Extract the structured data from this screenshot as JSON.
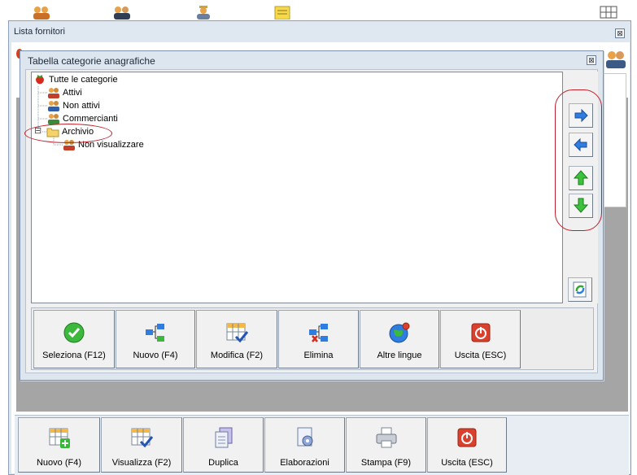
{
  "outer_window": {
    "title": "Lista fornitori",
    "close_glyph": "⊠",
    "bottom_buttons": [
      {
        "label": "Nuovo (F4)",
        "icon": "grid-add-icon"
      },
      {
        "label": "Visualizza (F2)",
        "icon": "grid-check-icon"
      },
      {
        "label": "Duplica",
        "icon": "duplicate-icon"
      },
      {
        "label": "Elaborazioni",
        "icon": "gear-document-icon"
      },
      {
        "label": "Stampa (F9)",
        "icon": "printer-icon"
      },
      {
        "label": "Uscita (ESC)",
        "icon": "power-icon"
      }
    ]
  },
  "dialog": {
    "title": "Tabella categorie anagrafiche",
    "close_glyph": "⊠",
    "tree": [
      {
        "label": "Tutte le categorie",
        "icon": "strawberry-icon",
        "level": 0
      },
      {
        "label": "Attivi",
        "icon": "users-icon",
        "level": 1
      },
      {
        "label": "Non attivi",
        "icon": "users-icon",
        "level": 1
      },
      {
        "label": "Commercianti",
        "icon": "users-icon",
        "level": 1
      },
      {
        "label": "Archivio",
        "icon": "folder-icon",
        "level": 1,
        "expanded": true,
        "expander": "⊟",
        "highlighted": true
      },
      {
        "label": "Non visualizzare",
        "icon": "users-icon",
        "level": 2
      }
    ],
    "side_buttons": [
      {
        "name": "move-right",
        "icon": "arrow-right-icon"
      },
      {
        "name": "move-left",
        "icon": "arrow-left-icon"
      },
      {
        "name": "move-up",
        "icon": "arrow-up-icon"
      },
      {
        "name": "move-down",
        "icon": "arrow-down-icon"
      },
      {
        "name": "refresh",
        "icon": "refresh-icon"
      }
    ],
    "buttons": [
      {
        "label": "Seleziona (F12)",
        "icon": "check-icon"
      },
      {
        "label": "Nuovo (F4)",
        "icon": "new-node-icon"
      },
      {
        "label": "Modifica (F2)",
        "icon": "grid-check-icon"
      },
      {
        "label": "Elimina",
        "icon": "delete-node-icon"
      },
      {
        "label": "Altre lingue",
        "icon": "globe-icon"
      },
      {
        "label": "Uscita (ESC)",
        "icon": "power-icon"
      }
    ]
  },
  "colors": {
    "window_bg": "#dde5ef",
    "accent_red": "#c0202a",
    "arrow_blue": "#2f7de0",
    "arrow_green": "#2fb82f"
  }
}
